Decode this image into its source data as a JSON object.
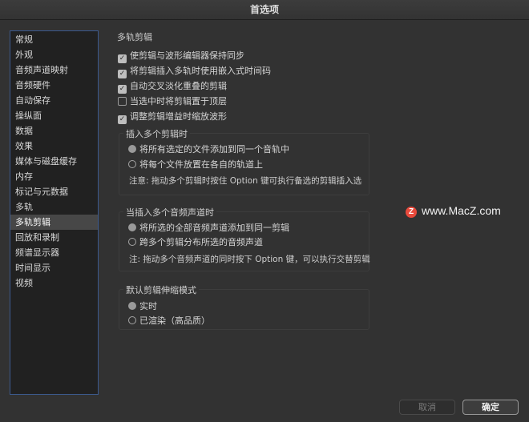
{
  "window": {
    "title": "首选项"
  },
  "sidebar": {
    "items": [
      {
        "label": "常规"
      },
      {
        "label": "外观"
      },
      {
        "label": "音频声道映射"
      },
      {
        "label": "音频硬件"
      },
      {
        "label": "自动保存"
      },
      {
        "label": "操纵面"
      },
      {
        "label": "数据"
      },
      {
        "label": "效果"
      },
      {
        "label": "媒体与磁盘缓存"
      },
      {
        "label": "内存"
      },
      {
        "label": "标记与元数据"
      },
      {
        "label": "多轨"
      },
      {
        "label": "多轨剪辑"
      },
      {
        "label": "回放和录制"
      },
      {
        "label": "频谱显示器"
      },
      {
        "label": "时间显示"
      },
      {
        "label": "视频"
      }
    ],
    "selected": "多轨剪辑"
  },
  "main": {
    "section_title": "多轨剪辑",
    "checkboxes": [
      {
        "label": "使剪辑与波形编辑器保持同步",
        "checked": true
      },
      {
        "label": "将剪辑插入多轨时使用嵌入式时间码",
        "checked": true
      },
      {
        "label": "自动交叉淡化重叠的剪辑",
        "checked": true
      },
      {
        "label": "当选中时将剪辑置于顶层",
        "checked": false
      },
      {
        "label": "调整剪辑增益时缩放波形",
        "checked": true
      }
    ],
    "insert_multiple": {
      "title": "插入多个剪辑时",
      "options": [
        {
          "label": "将所有选定的文件添加到同一个音轨中",
          "selected": true
        },
        {
          "label": "将每个文件放置在各自的轨道上",
          "selected": false
        }
      ],
      "note": "注意: 拖动多个剪辑时按住 Option 键可执行备选的剪辑插入选"
    },
    "insert_channels": {
      "title": "当插入多个音频声道时",
      "options": [
        {
          "label": "将所选的全部音频声道添加到同一剪辑",
          "selected": true
        },
        {
          "label": "跨多个剪辑分布所选的音频声道",
          "selected": false
        }
      ],
      "note": "注: 拖动多个音频声道的同时按下 Option 键，可以执行交替剪辑"
    },
    "stretch_mode": {
      "title": "默认剪辑伸缩模式",
      "options": [
        {
          "label": "实时",
          "selected": true
        },
        {
          "label": "已渲染（高品质）",
          "selected": false
        }
      ]
    }
  },
  "watermark": {
    "logo_letter": "Z",
    "text": "www.MacZ.com"
  },
  "footer": {
    "cancel_label": "取消",
    "ok_label": "确定"
  },
  "icons": {
    "check": "✓"
  },
  "colors": {
    "selection": "#474747",
    "sidebar_border": "#3c5a8e",
    "logo": "#e84a3c"
  }
}
